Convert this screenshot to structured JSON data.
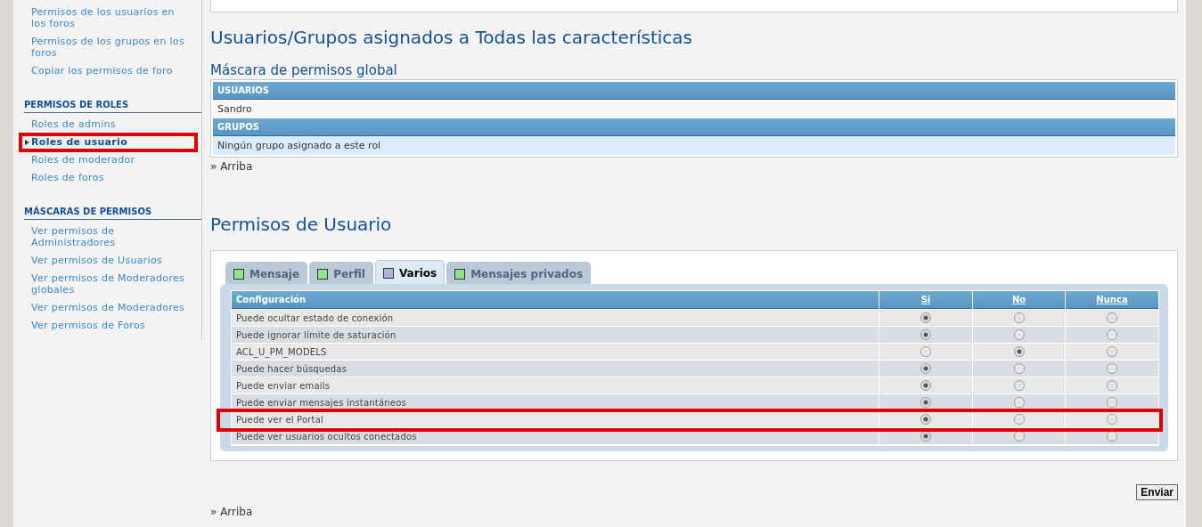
{
  "sidebar": {
    "sections": [
      {
        "items": [
          {
            "label": "Permisos de los usuarios en los foros",
            "selected": false,
            "highlighted": false
          },
          {
            "label": "Permisos de los grupos en los foros",
            "selected": false,
            "highlighted": false
          },
          {
            "label": "Copiar los permisos de foro",
            "selected": false,
            "highlighted": false
          }
        ]
      },
      {
        "title": "PERMISOS DE ROLES",
        "items": [
          {
            "label": "Roles de admins",
            "selected": false,
            "highlighted": false
          },
          {
            "label": "Roles de usuario",
            "selected": true,
            "highlighted": true
          },
          {
            "label": "Roles de moderador",
            "selected": false,
            "highlighted": false
          },
          {
            "label": "Roles de foros",
            "selected": false,
            "highlighted": false
          }
        ]
      },
      {
        "title": "MÁSCARAS DE PERMISOS",
        "items": [
          {
            "label": "Ver permisos de Administradores",
            "selected": false,
            "highlighted": false
          },
          {
            "label": "Ver permisos de Usuarios",
            "selected": false,
            "highlighted": false
          },
          {
            "label": "Ver permisos de Moderadores globales",
            "selected": false,
            "highlighted": false
          },
          {
            "label": "Ver permisos de Moderadores",
            "selected": false,
            "highlighted": false
          },
          {
            "label": "Ver permisos de Foros",
            "selected": false,
            "highlighted": false
          }
        ]
      }
    ]
  },
  "assigned": {
    "title": "Usuarios/Grupos asignados a Todas las características",
    "subtitle": "Máscara de permisos global",
    "users_header": "USUARIOS",
    "users": [
      "Sandro"
    ],
    "groups_header": "GRUPOS",
    "groups_empty": "Ningún grupo asignado a este rol",
    "top_link": "» Arriba"
  },
  "permissions": {
    "title": "Permisos de Usuario",
    "tabs": [
      {
        "label": "Mensaje",
        "selected": false
      },
      {
        "label": "Perfil",
        "selected": false
      },
      {
        "label": "Varios",
        "selected": true
      },
      {
        "label": "Mensajes privados",
        "selected": false
      }
    ],
    "columns": [
      "Configuración",
      "Sí",
      "No",
      "Nunca"
    ],
    "rows": [
      {
        "label": "Puede ocultar estado de conexión",
        "options": [
          {
            "selected": true
          },
          {
            "selected": false
          },
          {
            "selected": false
          }
        ],
        "highlighted": false
      },
      {
        "label": "Puede ignorar límite de saturación",
        "options": [
          {
            "selected": true
          },
          {
            "selected": false
          },
          {
            "selected": false
          }
        ],
        "highlighted": false
      },
      {
        "label": "ACL_U_PM_MODELS",
        "options": [
          {
            "selected": false
          },
          {
            "selected": true
          },
          {
            "selected": false
          }
        ],
        "highlighted": false
      },
      {
        "label": "Puede hacer búsquedas",
        "options": [
          {
            "selected": true
          },
          {
            "selected": false
          },
          {
            "selected": false
          }
        ],
        "highlighted": false
      },
      {
        "label": "Puede enviar emails",
        "options": [
          {
            "selected": true
          },
          {
            "selected": false
          },
          {
            "selected": false
          }
        ],
        "highlighted": false
      },
      {
        "label": "Puede enviar mensajes instantáneos",
        "options": [
          {
            "selected": true
          },
          {
            "selected": false
          },
          {
            "selected": false
          }
        ],
        "highlighted": false
      },
      {
        "label": "Puede ver el Portal",
        "options": [
          {
            "selected": true
          },
          {
            "selected": false
          },
          {
            "selected": false
          }
        ],
        "highlighted": true
      },
      {
        "label": "Puede ver usuarios ocultos conectados",
        "options": [
          {
            "selected": true
          },
          {
            "selected": false
          },
          {
            "selected": false
          }
        ],
        "highlighted": false
      }
    ],
    "submit": "Enviar",
    "top_link": "» Arriba"
  }
}
